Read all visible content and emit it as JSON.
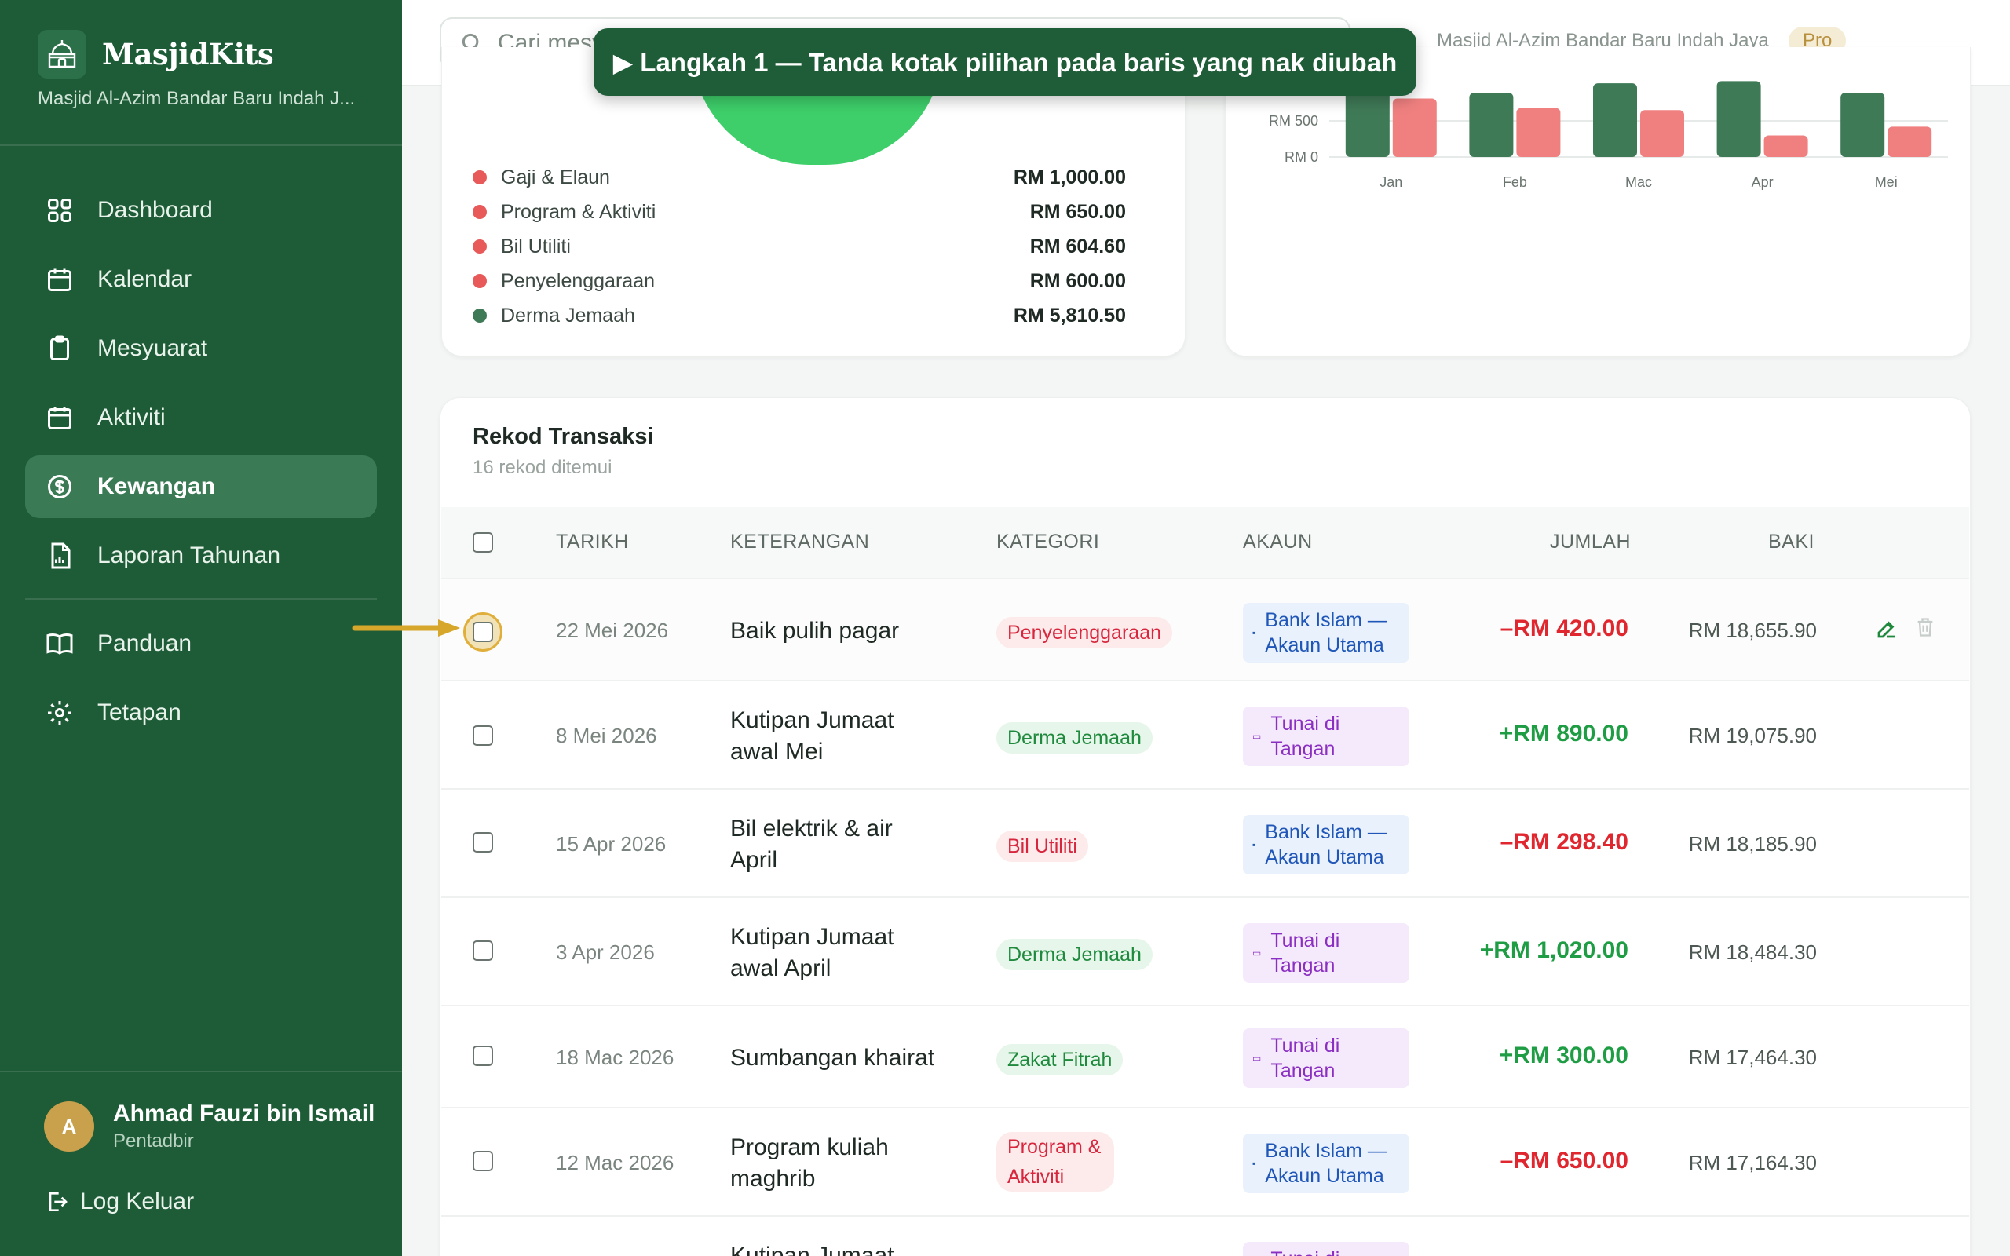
{
  "brand": {
    "name": "MasjidKits",
    "subtitle": "Masjid Al-Azim Bandar Baru Indah J..."
  },
  "nav": {
    "items": [
      {
        "label": "Dashboard",
        "icon": "grid-icon"
      },
      {
        "label": "Kalendar",
        "icon": "calendar-icon"
      },
      {
        "label": "Mesyuarat",
        "icon": "clipboard-icon"
      },
      {
        "label": "Aktiviti",
        "icon": "calendar-icon"
      },
      {
        "label": "Kewangan",
        "icon": "dollar-circle-icon",
        "active": true
      },
      {
        "label": "Laporan Tahunan",
        "icon": "report-icon"
      }
    ],
    "secondary": [
      {
        "label": "Panduan",
        "icon": "book-icon"
      },
      {
        "label": "Tetapan",
        "icon": "gear-icon"
      }
    ]
  },
  "user": {
    "initial": "A",
    "name": "Ahmad Fauzi bin Ismail",
    "role": "Pentadbir",
    "logout": "Log Keluar"
  },
  "topbar": {
    "search_placeholder": "Cari mesy",
    "mosque": "Masjid Al-Azim Bandar Baru Indah Jaya",
    "plan": "Pro"
  },
  "tooltip": {
    "text": "▶ Langkah 1 — Tanda kotak pilihan pada baris yang nak diubah"
  },
  "legend": [
    {
      "label": "Gaji & Elaun",
      "value": "RM 1,000.00",
      "color": "#e85a5a"
    },
    {
      "label": "Program & Aktiviti",
      "value": "RM 650.00",
      "color": "#e85a5a"
    },
    {
      "label": "Bil Utiliti",
      "value": "RM 604.60",
      "color": "#e85a5a"
    },
    {
      "label": "Penyelenggaraan",
      "value": "RM 600.00",
      "color": "#e85a5a"
    },
    {
      "label": "Derma Jemaah",
      "value": "RM 5,810.50",
      "color": "#3f7a57"
    }
  ],
  "chart_data": {
    "type": "bar",
    "categories": [
      "Jan",
      "Feb",
      "Mac",
      "Apr",
      "Mei"
    ],
    "series": [
      {
        "values": [
          1150,
          890,
          1020,
          1050,
          890
        ],
        "color": "#3f7a57"
      },
      {
        "values": [
          810,
          680,
          650,
          298.4,
          420
        ],
        "color": "#f08080"
      }
    ],
    "y_tick_labels": [
      "RM 500",
      "RM 0"
    ],
    "ylim": [
      0,
      1000
    ]
  },
  "transactions": {
    "title": "Rekod Transaksi",
    "count": "16 rekod ditemui",
    "headers": {
      "date": "TARIKH",
      "desc": "KETERANGAN",
      "category": "KATEGORI",
      "account": "AKAUN",
      "amount": "JUMLAH",
      "balance": "BAKI"
    },
    "rows": [
      {
        "date": "22 Mei 2026",
        "desc": "Baik pulih pagar",
        "category": "Penyelenggaraan",
        "cat_type": "red",
        "account": "Bank Islam — Akaun Utama",
        "acct_type": "bank",
        "amount": "–RM 420.00",
        "sign": "neg",
        "balance": "RM 18,655.90"
      },
      {
        "date": "8 Mei 2026",
        "desc": "Kutipan Jumaat awal Mei",
        "category": "Derma Jemaah",
        "cat_type": "green",
        "account": "Tunai di Tangan",
        "acct_type": "cash",
        "amount": "+RM 890.00",
        "sign": "pos",
        "balance": "RM 19,075.90"
      },
      {
        "date": "15 Apr 2026",
        "desc": "Bil elektrik & air April",
        "category": "Bil Utiliti",
        "cat_type": "red",
        "account": "Bank Islam — Akaun Utama",
        "acct_type": "bank",
        "amount": "–RM 298.40",
        "sign": "neg",
        "balance": "RM 18,185.90"
      },
      {
        "date": "3 Apr 2026",
        "desc": "Kutipan Jumaat awal April",
        "category": "Derma Jemaah",
        "cat_type": "green",
        "account": "Tunai di Tangan",
        "acct_type": "cash",
        "amount": "+RM 1,020.00",
        "sign": "pos",
        "balance": "RM 18,484.30"
      },
      {
        "date": "18 Mac 2026",
        "desc": "Sumbangan khairat",
        "category": "Zakat Fitrah",
        "cat_type": "green",
        "account": "Tunai di Tangan",
        "acct_type": "cash",
        "amount": "+RM 300.00",
        "sign": "pos",
        "balance": "RM 17,464.30"
      },
      {
        "date": "12 Mac 2026",
        "desc": "Program kuliah maghrib",
        "category": "Program & Aktiviti",
        "cat_type": "red",
        "account": "Bank Islam — Akaun Utama",
        "acct_type": "bank",
        "amount": "–RM 650.00",
        "sign": "neg",
        "balance": "RM 17,164.30"
      },
      {
        "date": "",
        "desc": "Kutipan Jumaat",
        "category": "",
        "cat_type": "green",
        "account": "Tunai di",
        "acct_type": "cash",
        "amount": "",
        "sign": "pos",
        "balance": ""
      }
    ]
  }
}
